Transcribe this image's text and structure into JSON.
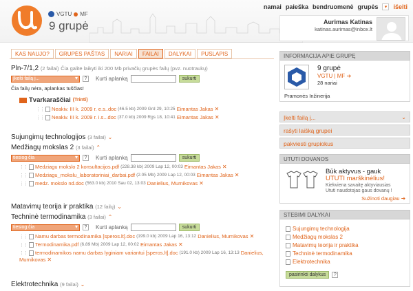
{
  "header": {
    "org": "VGTU",
    "faculty": "MF",
    "group_title": "9 grupė",
    "nav": [
      "namai",
      "paieška",
      "bendruomenė",
      "grupės"
    ],
    "logout": "išeiti",
    "user_name": "Aurimas Katinas",
    "user_email": "katinas.aurimas@inbox.lt"
  },
  "tabs": [
    "KAS NAUJO?",
    "GRUPĖS PAŠTAS",
    "NARIAI",
    "FAILAI",
    "DALYKAI",
    "PUSLAPIS"
  ],
  "active_tab": "FAILAI",
  "main": {
    "pin": {
      "title": "Pln-7/1,2",
      "count": "(2 failai)",
      "note": "Čia galite laikyti iki 200 Mb privačių grupės failų (pvz. nuotraukų)",
      "select": "Įkelti failą į...",
      "help": "?",
      "label": "Kurti aplanką",
      "button": "sukurti",
      "empty": "Čia failų nėra, aplankas tuščias!",
      "folder": "Tvarkaraščiai",
      "folder_action": "(Trinti)",
      "files": [
        {
          "name": "Neakiv. III k. 2009 r. e.s..doc",
          "meta": "(46.5 kb) 2009 Grd 29, 10:25",
          "author": "Eimantas Jakas"
        },
        {
          "name": "Neakiv. III k. 2009 r. i.s...doc",
          "meta": "(37.0 kb) 2009 Rgs 18, 10:41",
          "author": "Eimantas Jakas"
        }
      ]
    },
    "sujungimu": {
      "title": "Sujungimų technologijos",
      "count": "(3 failai)"
    },
    "medziagu": {
      "title": "Medžiagų mokslas 2",
      "count": "(3 failai)",
      "select": "tiesiog čia",
      "help": "?",
      "label": "Kurti aplanką",
      "button": "sukurti",
      "files": [
        {
          "name": "Medziagu mokslo 2 konsultacijos.pdf",
          "meta": "(228.38 kb) 2009 Lap 12, 00:03",
          "author": "Eimantas Jakas"
        },
        {
          "name": "Medziagu_mokslu_laboratoriniai_darbai.pdf",
          "meta": "(2.05 Mb) 2009 Lap 12, 00:03",
          "author": "Eimantas Jakas"
        },
        {
          "name": "medz. mokslo nd.doc",
          "meta": "(563.0 kb) 2010 Sau 02, 13:03",
          "author": "Danielius, Murnikovas"
        }
      ]
    },
    "matavimu": {
      "title": "Matavimų teorija ir praktika",
      "count": "(12 failų)"
    },
    "technine": {
      "title": "Techninė termodinamika",
      "count": "(3 failai)",
      "select": "tiesiog čia",
      "help": "?",
      "label": "Kurti aplanką",
      "button": "sukurti",
      "files": [
        {
          "name": "Namu darbas termodinamika [speros.lt].doc",
          "meta": "(199.0 kb) 2009 Lap 16, 13:12",
          "author": "Danielius, Murnikovas"
        },
        {
          "name": "Termodinamika.pdf",
          "meta": "(6.89 Mb) 2009 Lap 12, 00:02",
          "author": "Eimantas Jakas"
        },
        {
          "name": "termodinamikos namu darbas lyginiam variantui [speros.lt].doc",
          "meta": "(191.0 kb) 2009 Lap 16, 13:13",
          "author": "Danielius,"
        },
        {
          "name": "",
          "meta": "",
          "author": "Murnikovas"
        }
      ]
    },
    "elektro": {
      "title": "Elektrotechnika",
      "count": "(9 failai)"
    }
  },
  "sidebar": {
    "info_head": "INFORMACIJA APIE GRUPĘ",
    "group_name": "9 grupė",
    "group_org": "VGTU | MF",
    "members": "28 nariai",
    "field": "Pramonės Inžinerija",
    "links": [
      "Įkelti failą į...",
      "rašyti laišką grupei",
      "pakviesti grupiokus"
    ],
    "dovanos_head": "UTUTI DOVANOS",
    "promo_line1": "Būk aktyvus - gauk",
    "promo_line2": "UTUTI marškinėlius!",
    "promo_text1": "Kiekviena savaitę aktyviausias",
    "promo_text2": "Ututi naudotojas gaus dovanų !",
    "promo_more": "Sužinoti daugiau",
    "stebi_head": "STEBIMI DALYKAI",
    "stebi": [
      "Sujungimų technologija",
      "Medžiagų mokslas 2",
      "Matavimų teorija ir praktika",
      "Techninė termodinamika",
      "Elektrotechnika"
    ],
    "stebi_button": "pasirinkti dalykus",
    "stebi_help": "?"
  }
}
